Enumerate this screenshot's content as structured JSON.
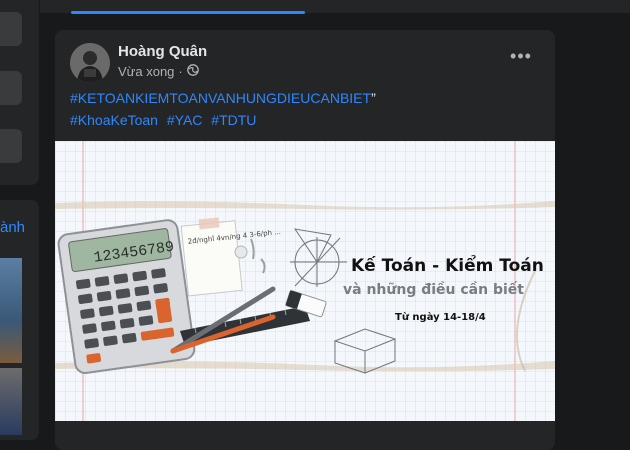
{
  "left": {
    "link_fragment": "ành"
  },
  "post": {
    "author": "Hoàng Quân",
    "time": "Vừa xong",
    "separator": "·",
    "privacy_icon": "globe-icon",
    "more_label": "•••",
    "line1_tag": "#KETOANKIEMTOANVANHUNGDIEUCANBIET",
    "line1_quote": "”",
    "tags": [
      "#KhoaKeToan",
      "#YAC",
      "#TDTU"
    ]
  },
  "banner": {
    "title_line1": "Kế Toán - Kiểm Toán",
    "title_line2": "và những điều cần biết",
    "date": "Từ ngày 14-18/4",
    "calculator_display": "123456789",
    "note_text": "2đ/nghĩ 4vn/ng 4 3-6/ph ..."
  },
  "colors": {
    "link": "#2d88ff",
    "card": "#242526",
    "bg": "#18191a"
  }
}
